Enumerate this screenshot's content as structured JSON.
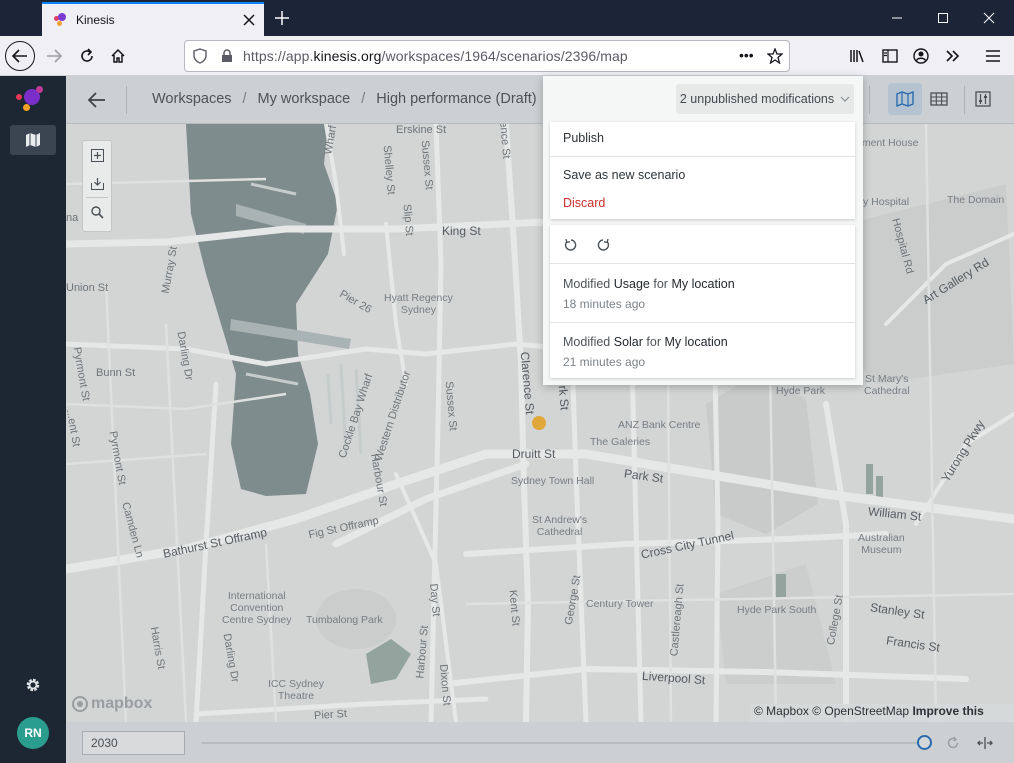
{
  "browser": {
    "tab_title": "Kinesis",
    "url_prefix": "https://app.",
    "url_domain": "kinesis.org",
    "url_path": "/workspaces/1964/scenarios/2396/map",
    "page_actions": "•••"
  },
  "sidebar": {
    "user_initials": "RN"
  },
  "header": {
    "breadcrumbs": [
      {
        "label": "Workspaces"
      },
      {
        "label": "My workspace"
      },
      {
        "label": "High performance (Draft)"
      }
    ],
    "separator": "/"
  },
  "modifications": {
    "trigger_label": "2 unpublished modifications",
    "menu": {
      "publish": "Publish",
      "save_as_new": "Save as new scenario",
      "discard": "Discard"
    },
    "history": [
      {
        "verb": "Modified",
        "attribute": "Usage",
        "preposition": "for",
        "target": "My location",
        "time": "18 minutes ago"
      },
      {
        "verb": "Modified",
        "attribute": "Solar",
        "preposition": "for",
        "target": "My location",
        "time": "21 minutes ago"
      }
    ]
  },
  "map": {
    "labels": {
      "king_st": "King St",
      "druitt_st": "Druitt St",
      "park_st": "Park St",
      "william_st": "William St",
      "liverpool_st": "Liverpool St",
      "bathurst_offramp": "Bathurst St Offramp",
      "fig_offramp": "Fig St Offramp",
      "cross_city": "Cross City Tunnel",
      "pier26": "Pier 26",
      "hyatt": "Hyatt Regency\nSydney",
      "anz": "ANZ Bank Centre",
      "galeries": "The Galeries",
      "town_hall": "Sydney Town Hall",
      "st_andrews": "St Andrew's\nCathedral",
      "century": "Century Tower",
      "hyde_park": "Hyde Park",
      "hyde_park_south": "Hyde Park South",
      "st_marys": "St Mary's\nCathedral",
      "aus_museum": "Australian\nMuseum",
      "iccs": "International\nConvention\nCentre Sydney",
      "tumbalong": "Tumbalong Park",
      "icc_theatre": "ICC Sydney\nTheatre",
      "the_domain": "The Domain",
      "sydney_hospital": "y Hospital",
      "parl_house": "ament House",
      "art_gallery_rd": "Art Gallery Rd",
      "hospital_rd": "Hospital Rd",
      "yurong": "Yurong Pkwy",
      "stanley": "Stanley St",
      "francis": "Francis St",
      "bunn": "Bunn St",
      "union": "Union St",
      "murray": "Murray St",
      "darling_dr": "Darling Dr",
      "pyrmont_st": "Pyrmont St",
      "pyrmont_st2": "Pyrmont St",
      "harris": "Harris St",
      "darling_dr2": "Darling Dr",
      "harbour_st": "Harbour St",
      "day_st": "Day St",
      "dixon": "Dixon St",
      "kent": "Kent St",
      "george": "George St",
      "castlereagh": "Castlereagh St",
      "college": "College St",
      "clarence": "Clarence St",
      "york": "York St",
      "sussex": "Sussex St",
      "sussex2": "Sussex St",
      "slip": "Slip St",
      "shelley": "Shelley St",
      "erskine": "Erskine St",
      "pier_st": "Pier St",
      "western_dist": "Western Distributor",
      "cockle_bay": "Cockle Bay Wharf",
      "harbour_st2": "Harbour St",
      "camden": "Camden Ln",
      "jones_bay": "...ent St",
      "na_rd": "na Rd",
      "wharf": "Wharf",
      "ence_st": "ence St"
    },
    "mapbox": "mapbox",
    "attribution_mapbox": "© Mapbox",
    "attribution_osm": "© OpenStreetMap",
    "attribution_improve": "Improve this map"
  },
  "timeline": {
    "year": "2030"
  }
}
